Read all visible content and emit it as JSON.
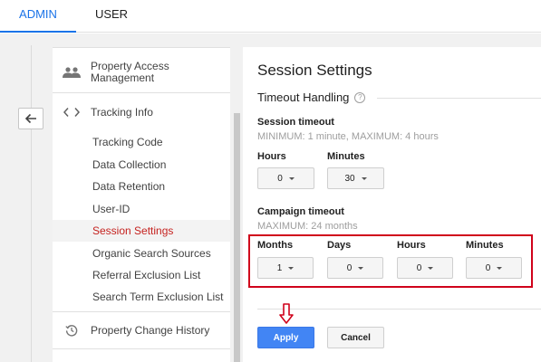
{
  "tabs": {
    "admin": "ADMIN",
    "user": "USER"
  },
  "nav": {
    "property_access": "Property Access Management",
    "tracking_info": "Tracking Info",
    "items": [
      {
        "label": "Tracking Code"
      },
      {
        "label": "Data Collection"
      },
      {
        "label": "Data Retention"
      },
      {
        "label": "User-ID"
      },
      {
        "label": "Session Settings"
      },
      {
        "label": "Organic Search Sources"
      },
      {
        "label": "Referral Exclusion List"
      },
      {
        "label": "Search Term Exclusion List"
      }
    ],
    "active_item": "Session Settings",
    "change_history": "Property Change History"
  },
  "main": {
    "title": "Session Settings",
    "section": "Timeout Handling",
    "help": "?",
    "session_timeout": {
      "title": "Session timeout",
      "sub": "MINIMUM: 1 minute, MAXIMUM: 4 hours",
      "hours_label": "Hours",
      "hours_value": "0",
      "minutes_label": "Minutes",
      "minutes_value": "30"
    },
    "campaign_timeout": {
      "title": "Campaign timeout",
      "sub": "MAXIMUM: 24 months",
      "months_label": "Months",
      "months_value": "1",
      "days_label": "Days",
      "days_value": "0",
      "hours_label": "Hours",
      "hours_value": "0",
      "minutes_label": "Minutes",
      "minutes_value": "0"
    },
    "apply": "Apply",
    "cancel": "Cancel"
  },
  "colors": {
    "accent": "#1a73e8",
    "active_nav": "#c5221f",
    "highlight_box": "#d0021b",
    "apply_button": "#4285f4"
  },
  "icons": [
    "people-icon",
    "code-icon",
    "back-arrow-icon",
    "history-icon",
    "help-icon",
    "caret-down-icon",
    "down-arrow-icon"
  ]
}
